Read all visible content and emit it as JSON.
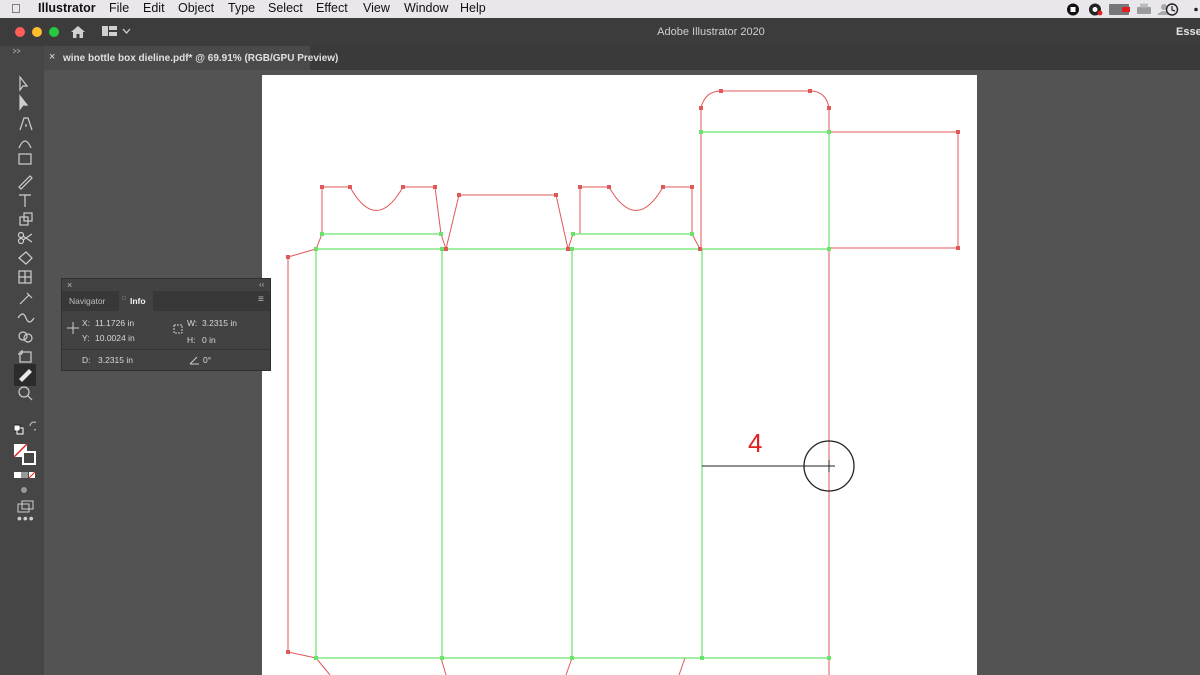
{
  "menubar": {
    "app_name": "Illustrator",
    "items": [
      "File",
      "Edit",
      "Object",
      "Type",
      "Select",
      "Effect",
      "View",
      "Window",
      "Help"
    ]
  },
  "window": {
    "title": "Adobe Illustrator 2020",
    "workspace_label": "Esse"
  },
  "document_tab": {
    "close_glyph": "×",
    "label": "wine bottle box dieline.pdf* @ 69.91% (RGB/GPU Preview)"
  },
  "info_panel": {
    "tabs": [
      "Navigator",
      "Info"
    ],
    "active_tab": "Info",
    "x_label": "X:",
    "x_value": "11.1726 in",
    "y_label": "Y:",
    "y_value": "10.0024 in",
    "w_label": "W:",
    "w_value": "3.2315 in",
    "h_label": "H:",
    "h_value": "0 in",
    "d_label": "D:",
    "d_value": "3.2315 in",
    "angle_value": "0°"
  },
  "canvas": {
    "annotation": "4",
    "colors": {
      "cut_line": "#e05858",
      "fold_line": "#6be36b",
      "annotation": "#e02020",
      "measure": "#222222"
    }
  },
  "icons": [
    "apple-icon",
    "home-icon",
    "workspace-switcher-icon",
    "selection-tool-icon",
    "direct-selection-tool-icon",
    "pen-tool-icon",
    "curvature-tool-icon",
    "rectangle-tool-icon",
    "pencil-tool-icon",
    "type-tool-icon",
    "rotate-tool-icon",
    "scissors-tool-icon",
    "warp-tool-icon",
    "mesh-tool-icon",
    "eyedropper-tool-icon",
    "blend-tool-icon",
    "shape-builder-tool-icon",
    "artboard-tool-icon",
    "measure-tool-icon",
    "zoom-tool-icon",
    "fill-stroke-icon",
    "more-tools-icon"
  ]
}
